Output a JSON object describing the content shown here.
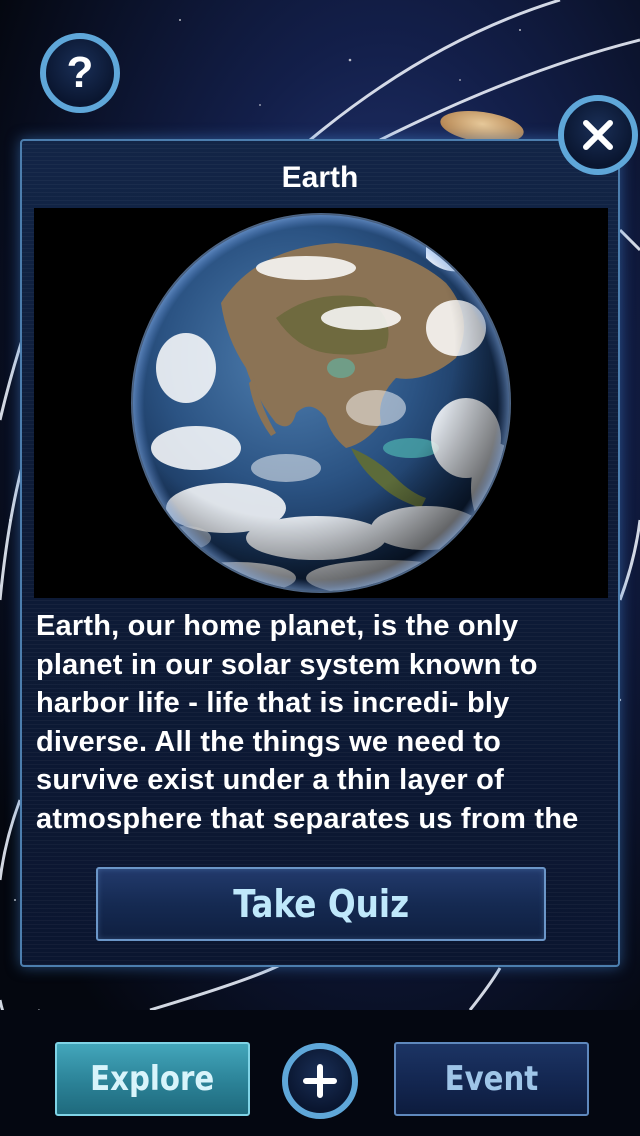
{
  "modal": {
    "title": "Earth",
    "image_alt": "Earth",
    "description": "Earth, our home planet, is the only planet in our solar system known to harbor life - life that is incredi- bly diverse. All the things we need to survive exist under a thin layer of atmosphere that separates us from the uninhabitable void of space.",
    "take_quiz_label": "Take Quiz"
  },
  "top": {
    "help_glyph": "?",
    "help_icon": "question-mark-icon",
    "close_icon": "close-x-icon"
  },
  "bottom_bar": {
    "explore_label": "Explore",
    "event_label": "Event",
    "add_icon": "plus-icon",
    "active_tab": "Explore"
  },
  "colors": {
    "accent_ring": "#5fa7d9",
    "modal_bg": "#0e1c38",
    "explore_tab": "#2b8297",
    "event_tab": "#132650",
    "quiz_text": "#bfe8fb"
  }
}
